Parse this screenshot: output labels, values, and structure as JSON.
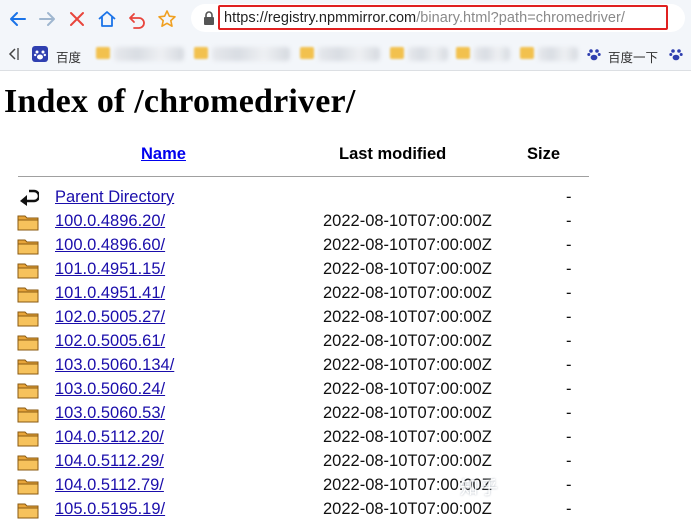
{
  "toolbar": {
    "back_icon": "arrow-left-icon",
    "forward_icon": "arrow-right-icon",
    "stop_icon": "close-icon",
    "home_icon": "home-icon",
    "undo_icon": "undo-icon",
    "star_icon": "star-icon",
    "accent_color": "#1a73e8",
    "stop_color": "#e8453c",
    "highlight_color": "#e02020"
  },
  "address": {
    "url_main": "https://registry.npmmirror.com",
    "url_path": "/binary.html?path=chromedriver/"
  },
  "bookmarks": {
    "first_label": "百度",
    "last_label": "百度一下"
  },
  "page": {
    "title": "Index of /chromedriver/",
    "columns": {
      "name": "Name",
      "modified": "Last modified",
      "size": "Size"
    },
    "parent": {
      "label": "Parent Directory",
      "size": "-"
    },
    "rows": [
      {
        "name": "100.0.4896.20/",
        "modified": "2022-08-10T07:00:00Z",
        "size": "-"
      },
      {
        "name": "100.0.4896.60/",
        "modified": "2022-08-10T07:00:00Z",
        "size": "-"
      },
      {
        "name": "101.0.4951.15/",
        "modified": "2022-08-10T07:00:00Z",
        "size": "-"
      },
      {
        "name": "101.0.4951.41/",
        "modified": "2022-08-10T07:00:00Z",
        "size": "-"
      },
      {
        "name": "102.0.5005.27/",
        "modified": "2022-08-10T07:00:00Z",
        "size": "-"
      },
      {
        "name": "102.0.5005.61/",
        "modified": "2022-08-10T07:00:00Z",
        "size": "-"
      },
      {
        "name": "103.0.5060.134/",
        "modified": "2022-08-10T07:00:00Z",
        "size": "-"
      },
      {
        "name": "103.0.5060.24/",
        "modified": "2022-08-10T07:00:00Z",
        "size": "-"
      },
      {
        "name": "103.0.5060.53/",
        "modified": "2022-08-10T07:00:00Z",
        "size": "-"
      },
      {
        "name": "104.0.5112.20/",
        "modified": "2022-08-10T07:00:00Z",
        "size": "-"
      },
      {
        "name": "104.0.5112.29/",
        "modified": "2022-08-10T07:00:00Z",
        "size": "-"
      },
      {
        "name": "104.0.5112.79/",
        "modified": "2022-08-10T07:00:00Z",
        "size": "-"
      },
      {
        "name": "105.0.5195.19/",
        "modified": "2022-08-10T07:00:00Z",
        "size": "-"
      }
    ]
  },
  "watermark": "知乎"
}
